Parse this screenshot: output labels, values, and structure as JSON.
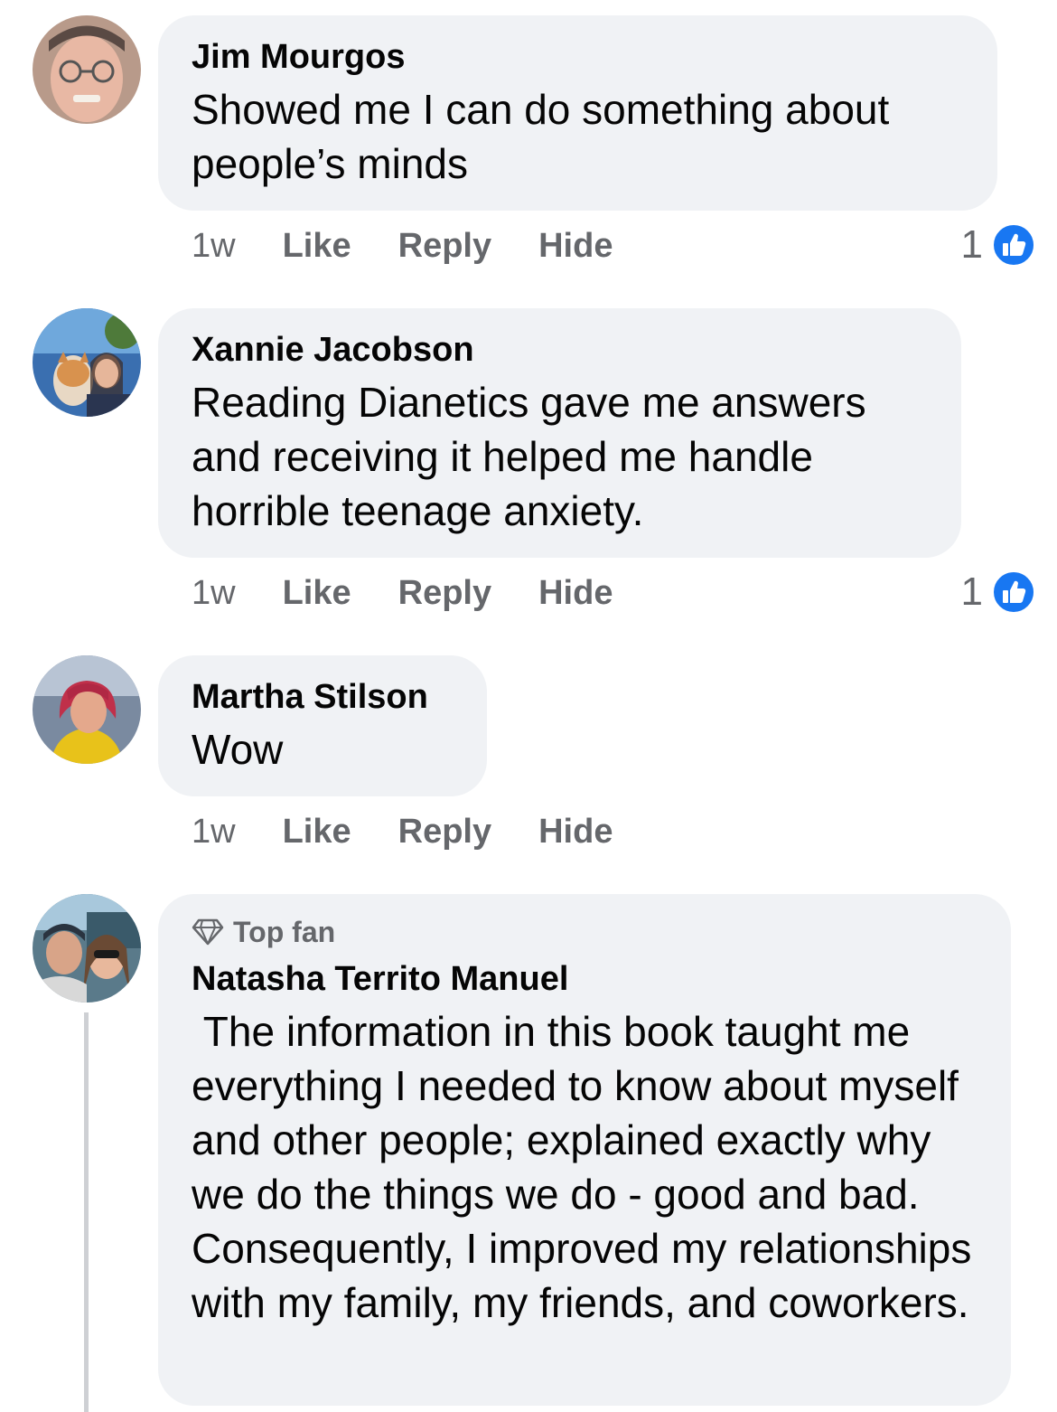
{
  "comments": [
    {
      "author": "Jim Mourgos",
      "text": "Showed me I can do something about people’s minds",
      "time": "1w",
      "like": "Like",
      "reply": "Reply",
      "hide": "Hide",
      "reaction_count": "1"
    },
    {
      "author": "Xannie Jacobson",
      "text": "Reading Dianetics gave me answers and receiving it helped me handle horrible teenage anxiety.",
      "time": "1w",
      "like": "Like",
      "reply": "Reply",
      "hide": "Hide",
      "reaction_count": "1"
    },
    {
      "author": "Martha Stilson",
      "text": "Wow",
      "time": "1w",
      "like": "Like",
      "reply": "Reply",
      "hide": "Hide"
    },
    {
      "badge": "Top fan",
      "author": "Natasha Territo Manuel",
      "text": " The information in this book taught me everything I needed to know about myself and other people; explained exactly why we do the things we do - good and bad. Consequently, I improved my relationships with my family, my friends, and coworkers."
    }
  ],
  "colors": {
    "bubble": "#f0f2f5",
    "meta_text": "#65676b",
    "like_blue": "#1877f2"
  },
  "icons": {
    "reaction": "like-reaction-icon",
    "badge": "diamond-icon"
  }
}
